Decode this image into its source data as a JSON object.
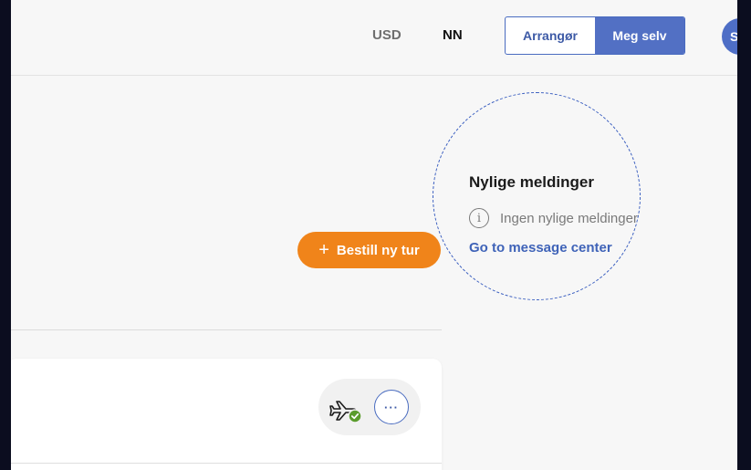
{
  "header": {
    "currency": "USD",
    "language": "NN",
    "role_toggle": {
      "options": [
        "Arrangør",
        "Meg selv"
      ],
      "selected": "Meg selv"
    },
    "avatar_initials": "SS"
  },
  "actions": {
    "book_label": "Bestill ny tur",
    "book_icon": "plus-icon"
  },
  "messages": {
    "title": "Nylige meldinger",
    "empty_text": "Ingen nylige meldinger",
    "info_icon": "info-icon",
    "link_label": "Go to message center"
  },
  "trip_card": {
    "status_icon": "flight-confirmed-icon",
    "more_label": "···"
  },
  "colors": {
    "accent": "#5270c4",
    "cta": "#f0841a",
    "confirmed": "#5a9c2c",
    "link": "#3f63b8"
  }
}
